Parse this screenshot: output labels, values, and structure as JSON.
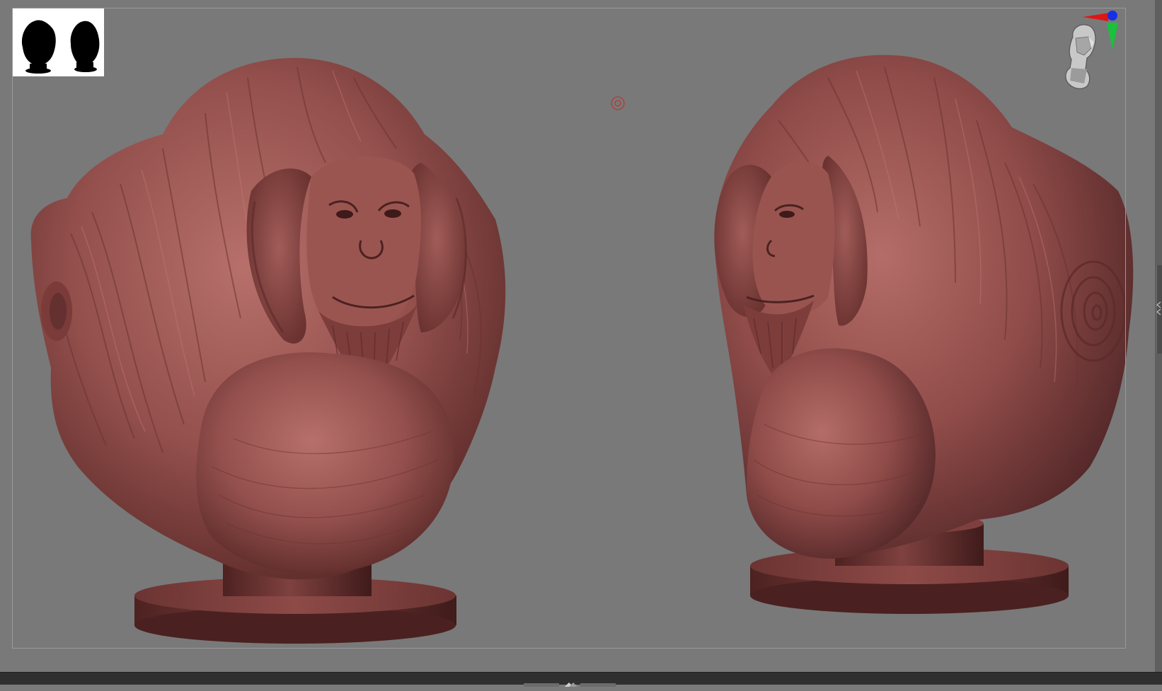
{
  "app": {
    "name": "",
    "theme": {
      "viewport_bg": "#797979",
      "model_color": "#8e4846",
      "model_shadow": "#3f1c1b",
      "model_highlight": "#b8706c",
      "bar_bg": "#2f2f2f"
    }
  },
  "viewport": {
    "models": [
      {
        "name": "orangutan-bust-front-three-quarter",
        "view": "front-left"
      },
      {
        "name": "orangutan-bust-side",
        "view": "left-profile"
      }
    ],
    "thumbnail": {
      "icon": "silhouette-preview-icon",
      "silhouettes": 2
    },
    "nav_cube": {
      "icon": "head-orientation-icon",
      "axes": [
        "x-red",
        "y-green",
        "z-blue"
      ]
    },
    "marker": {
      "icon": "pivot-target-icon"
    }
  },
  "tray": {
    "right_toggle_icon": "tray-collapse-icon",
    "bottom_toggle_icon": "tray-expand-icon"
  }
}
